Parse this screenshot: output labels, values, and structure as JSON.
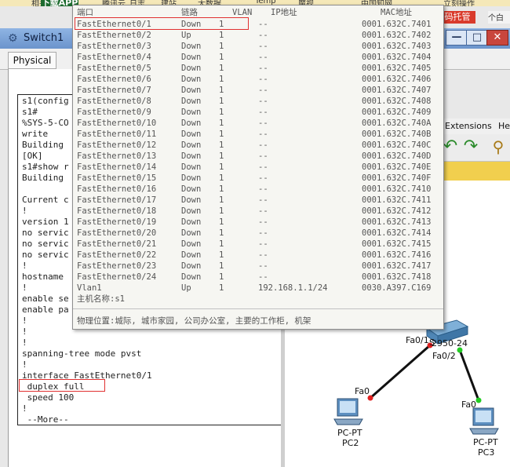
{
  "browser": {
    "download_label": "下载APP",
    "bookmarks": [
      "相关",
      "腾讯云",
      "日志",
      "建站",
      "大数据",
      "Temp",
      "魔视",
      "中国知网",
      "立刻操作"
    ],
    "managed_label": "码托管",
    "right_tab": "个白"
  },
  "window": {
    "title": "Switch1",
    "minimize": "—",
    "maximize": "□",
    "close": "✕"
  },
  "tabs": {
    "physical": "Physical"
  },
  "cli": {
    "lines": [
      "s1(config",
      "s1#",
      "%SYS-5-CO",
      "write",
      "Building",
      "[OK]",
      "s1#show r",
      "Building",
      "",
      "Current c",
      "!",
      "version 1",
      "no servic",
      "no servic",
      "no servic",
      "!",
      "hostname ",
      "!",
      "enable se",
      "enable pa",
      "!",
      "!",
      "!",
      "spanning-tree mode pvst",
      "!",
      "interface FastEthernet0/1",
      " duplex full",
      " speed 100",
      "!",
      " --More--"
    ]
  },
  "tooltip": {
    "headers": {
      "port": "端口",
      "link": "链路",
      "vlan": "VLAN",
      "ip": "IP地址",
      "mac": "MAC地址"
    },
    "rows": [
      {
        "port": "FastEthernet0/1",
        "link": "Down",
        "vlan": "1",
        "ip": "--",
        "mac": "0001.632C.7401"
      },
      {
        "port": "FastEthernet0/2",
        "link": "Up",
        "vlan": "1",
        "ip": "--",
        "mac": "0001.632C.7402"
      },
      {
        "port": "FastEthernet0/3",
        "link": "Down",
        "vlan": "1",
        "ip": "--",
        "mac": "0001.632C.7403"
      },
      {
        "port": "FastEthernet0/4",
        "link": "Down",
        "vlan": "1",
        "ip": "--",
        "mac": "0001.632C.7404"
      },
      {
        "port": "FastEthernet0/5",
        "link": "Down",
        "vlan": "1",
        "ip": "--",
        "mac": "0001.632C.7405"
      },
      {
        "port": "FastEthernet0/6",
        "link": "Down",
        "vlan": "1",
        "ip": "--",
        "mac": "0001.632C.7406"
      },
      {
        "port": "FastEthernet0/7",
        "link": "Down",
        "vlan": "1",
        "ip": "--",
        "mac": "0001.632C.7407"
      },
      {
        "port": "FastEthernet0/8",
        "link": "Down",
        "vlan": "1",
        "ip": "--",
        "mac": "0001.632C.7408"
      },
      {
        "port": "FastEthernet0/9",
        "link": "Down",
        "vlan": "1",
        "ip": "--",
        "mac": "0001.632C.7409"
      },
      {
        "port": "FastEthernet0/10",
        "link": "Down",
        "vlan": "1",
        "ip": "--",
        "mac": "0001.632C.740A"
      },
      {
        "port": "FastEthernet0/11",
        "link": "Down",
        "vlan": "1",
        "ip": "--",
        "mac": "0001.632C.740B"
      },
      {
        "port": "FastEthernet0/12",
        "link": "Down",
        "vlan": "1",
        "ip": "--",
        "mac": "0001.632C.740C"
      },
      {
        "port": "FastEthernet0/13",
        "link": "Down",
        "vlan": "1",
        "ip": "--",
        "mac": "0001.632C.740D"
      },
      {
        "port": "FastEthernet0/14",
        "link": "Down",
        "vlan": "1",
        "ip": "--",
        "mac": "0001.632C.740E"
      },
      {
        "port": "FastEthernet0/15",
        "link": "Down",
        "vlan": "1",
        "ip": "--",
        "mac": "0001.632C.740F"
      },
      {
        "port": "FastEthernet0/16",
        "link": "Down",
        "vlan": "1",
        "ip": "--",
        "mac": "0001.632C.7410"
      },
      {
        "port": "FastEthernet0/17",
        "link": "Down",
        "vlan": "1",
        "ip": "--",
        "mac": "0001.632C.7411"
      },
      {
        "port": "FastEthernet0/18",
        "link": "Down",
        "vlan": "1",
        "ip": "--",
        "mac": "0001.632C.7412"
      },
      {
        "port": "FastEthernet0/19",
        "link": "Down",
        "vlan": "1",
        "ip": "--",
        "mac": "0001.632C.7413"
      },
      {
        "port": "FastEthernet0/20",
        "link": "Down",
        "vlan": "1",
        "ip": "--",
        "mac": "0001.632C.7414"
      },
      {
        "port": "FastEthernet0/21",
        "link": "Down",
        "vlan": "1",
        "ip": "--",
        "mac": "0001.632C.7415"
      },
      {
        "port": "FastEthernet0/22",
        "link": "Down",
        "vlan": "1",
        "ip": "--",
        "mac": "0001.632C.7416"
      },
      {
        "port": "FastEthernet0/23",
        "link": "Down",
        "vlan": "1",
        "ip": "--",
        "mac": "0001.632C.7417"
      },
      {
        "port": "FastEthernet0/24",
        "link": "Down",
        "vlan": "1",
        "ip": "--",
        "mac": "0001.632C.7418"
      },
      {
        "port": "Vlan1",
        "link": "Up",
        "vlan": "1",
        "ip": "192.168.1.1/24",
        "mac": "0030.A397.C169"
      }
    ],
    "hostname_line": "主机名称:s1",
    "location_line": "物理位置:城际, 城市家园, 公司办公室, 主要的工作柜, 机架"
  },
  "workspace": {
    "menu_extensions": "Extensions",
    "menu_help": "Hel",
    "switch_model": "2950-24",
    "switch_label_prefix": "S",
    "port_fa01": "Fa0/1",
    "port_fa02": "Fa0/2",
    "pc2_port": "Fa0",
    "pc3_port": "Fa0",
    "pc2_type": "PC-PT",
    "pc2_name": "PC2",
    "pc3_type": "PC-PT",
    "pc3_name": "PC3"
  },
  "colors": {
    "link_down": "#e02020",
    "link_up": "#22cc22",
    "highlight": "#e03030"
  }
}
